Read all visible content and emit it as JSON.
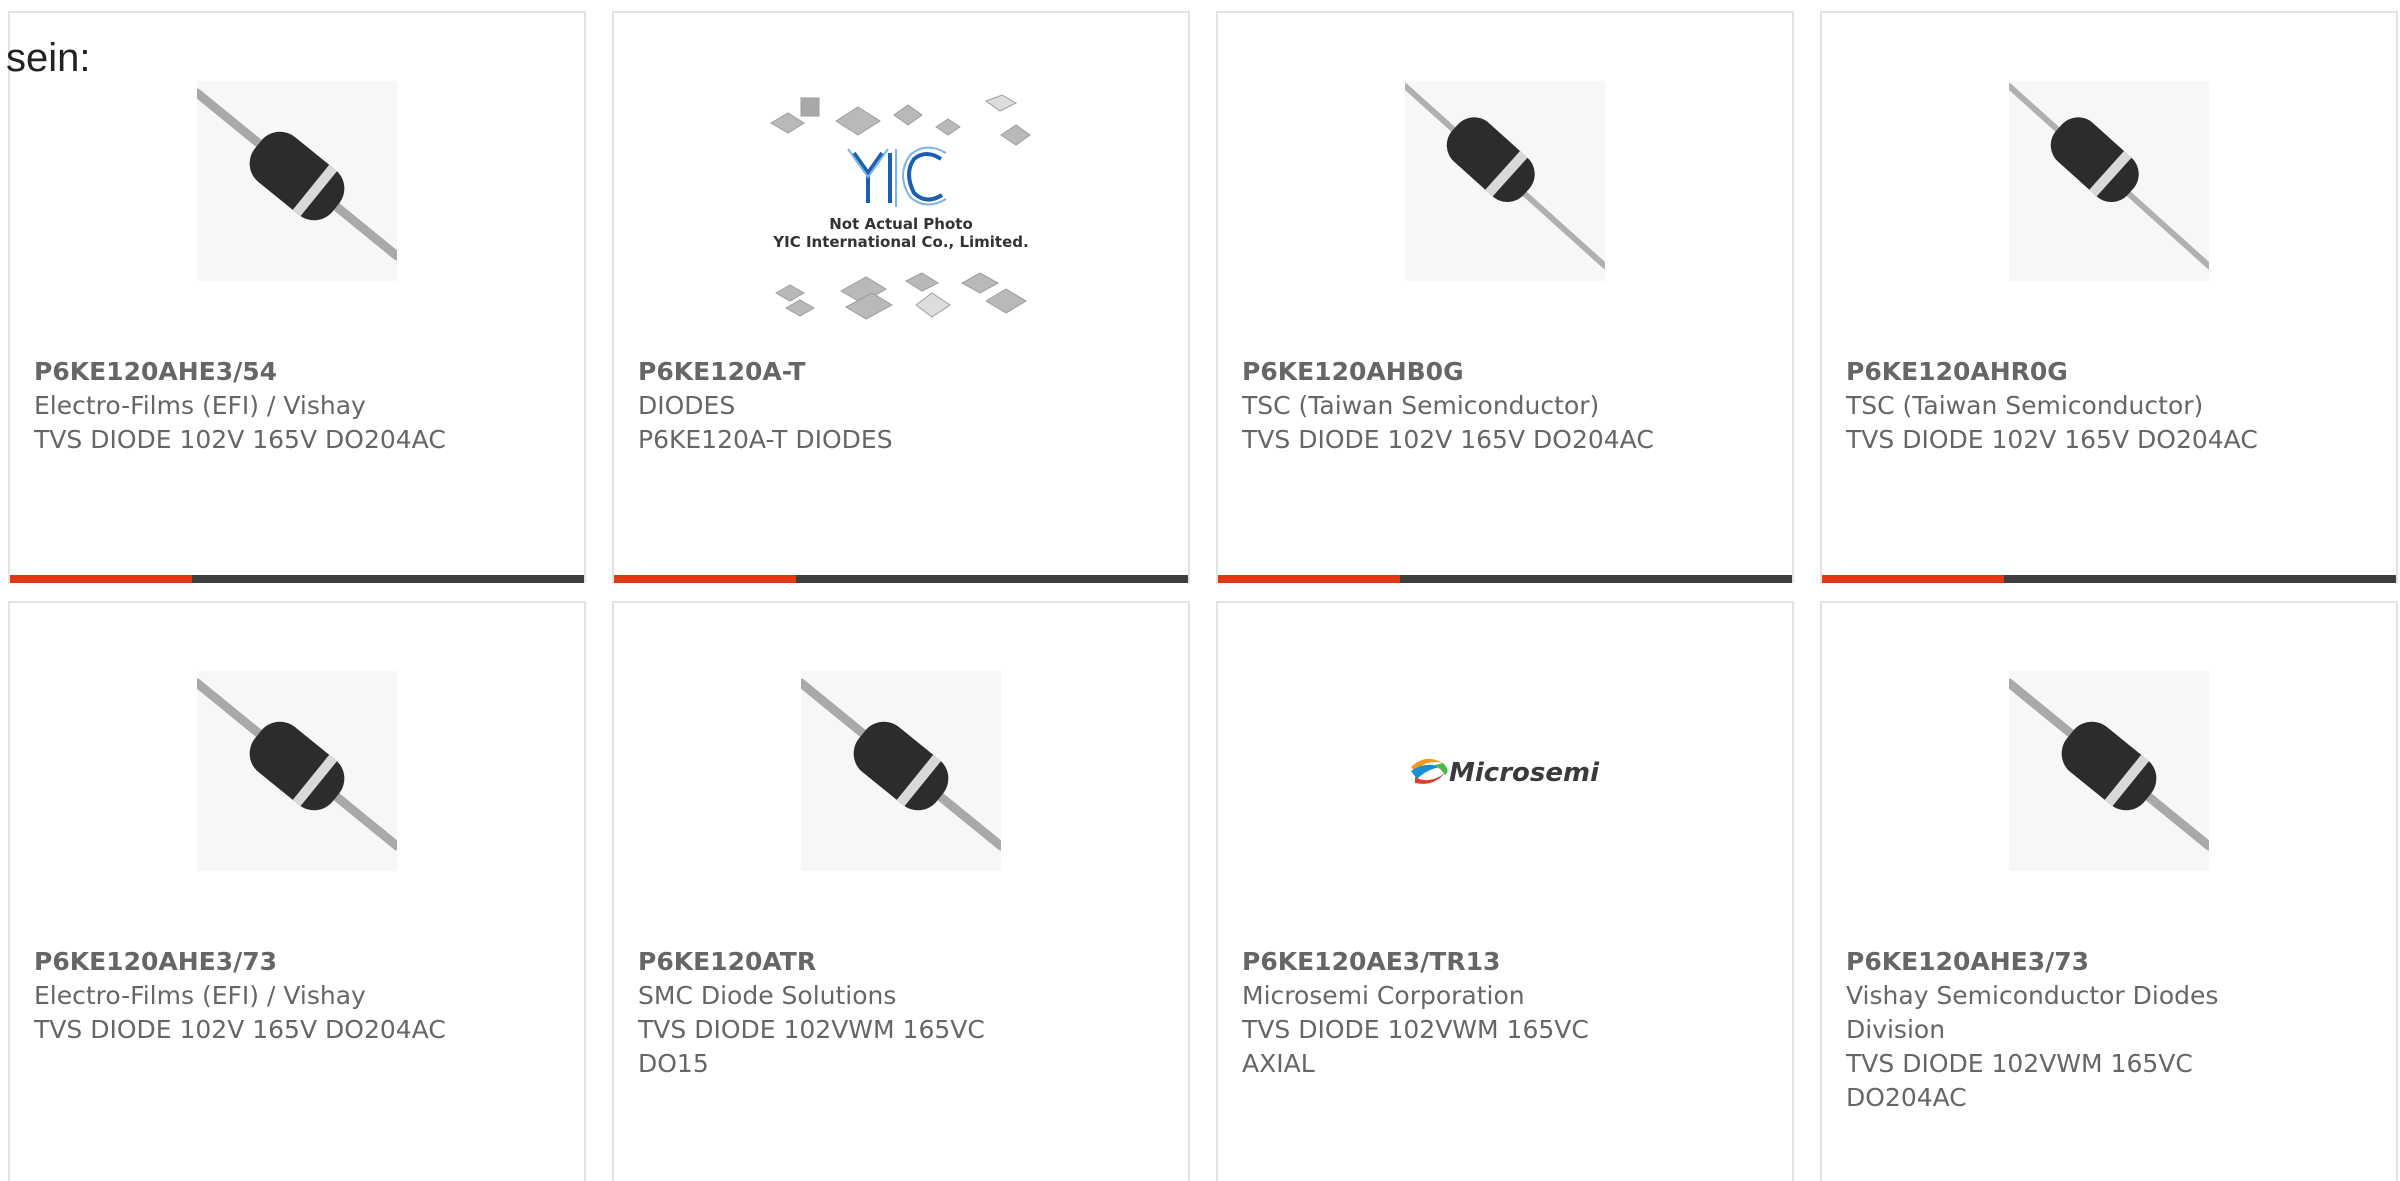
{
  "lead_text": "sein:",
  "colors": {
    "accent": "#e03812",
    "bar_dark": "#3e3e3e",
    "text": "#666666",
    "border": "#e3e3e3"
  },
  "products": [
    {
      "part": "P6KE120AHE3/54",
      "manufacturer": "Electro-Films (EFI) / Vishay",
      "description": "TVS DIODE 102V 165V DO204AC",
      "image": "axial-diode-image"
    },
    {
      "part": "P6KE120A-T",
      "manufacturer": "DIODES",
      "description": "P6KE120A-T DIODES",
      "image": "not-actual-photo-image",
      "image_caption_1": "Not Actual Photo",
      "image_caption_2": "YIC International Co., Limited."
    },
    {
      "part": "P6KE120AHB0G",
      "manufacturer": "TSC (Taiwan Semiconductor)",
      "description": "TVS DIODE 102V 165V DO204AC",
      "image": "axial-diode-image"
    },
    {
      "part": "P6KE120AHR0G",
      "manufacturer": "TSC (Taiwan Semiconductor)",
      "description": "TVS DIODE 102V 165V DO204AC",
      "image": "axial-diode-image"
    },
    {
      "part": "P6KE120AHE3/73",
      "manufacturer": "Electro-Films (EFI) / Vishay",
      "description": "TVS DIODE 102V 165V DO204AC",
      "image": "axial-diode-image"
    },
    {
      "part": "P6KE120ATR",
      "manufacturer": "SMC Diode Solutions",
      "description": "TVS DIODE 102VWM 165VC DO15",
      "image": "axial-diode-image"
    },
    {
      "part": "P6KE120AE3/TR13",
      "manufacturer": "Microsemi Corporation",
      "description": "TVS DIODE 102VWM 165VC AXIAL",
      "image": "microsemi-logo-image",
      "logo_text": "Microsemi"
    },
    {
      "part": "P6KE120AHE3/73",
      "manufacturer": "Vishay Semiconductor Diodes Division",
      "description": "TVS DIODE 102VWM 165VC DO204AC",
      "image": "axial-diode-image"
    }
  ]
}
